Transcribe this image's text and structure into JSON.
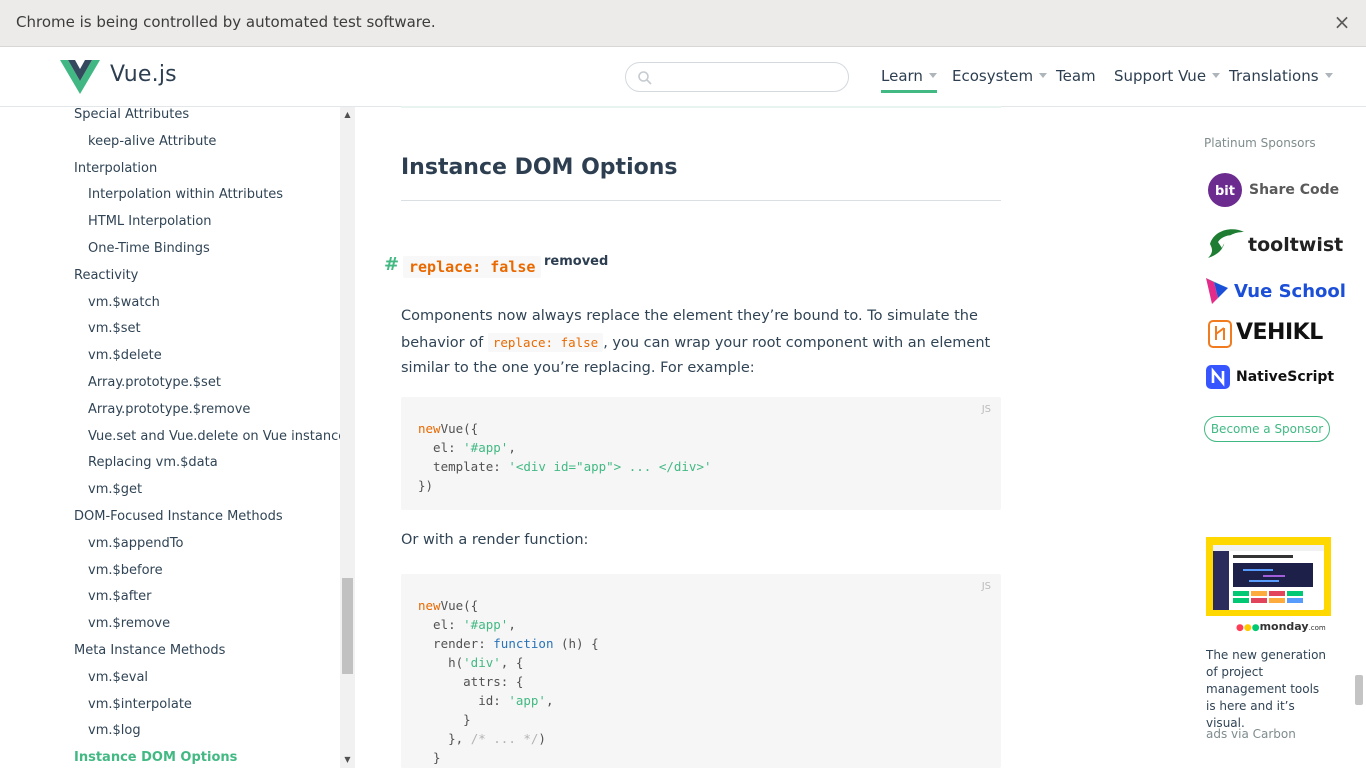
{
  "infobar": {
    "message": "Chrome is being controlled by automated test software.",
    "close_glyph": "×"
  },
  "header": {
    "brand": "Vue.js",
    "search_placeholder": "",
    "nav": {
      "learn": "Learn",
      "ecosystem": "Ecosystem",
      "team": "Team",
      "support": "Support Vue",
      "translations": "Translations"
    },
    "accent_color": "#42b983"
  },
  "sidebar": {
    "items": [
      {
        "label": "Special Attributes",
        "level": 1
      },
      {
        "label": "keep-alive Attribute",
        "level": 2
      },
      {
        "label": "Interpolation",
        "level": 1
      },
      {
        "label": "Interpolation within Attributes",
        "level": 2
      },
      {
        "label": "HTML Interpolation",
        "level": 2
      },
      {
        "label": "One-Time Bindings",
        "level": 2
      },
      {
        "label": "Reactivity",
        "level": 1
      },
      {
        "label": "vm.$watch",
        "level": 2
      },
      {
        "label": "vm.$set",
        "level": 2
      },
      {
        "label": "vm.$delete",
        "level": 2
      },
      {
        "label": "Array.prototype.$set",
        "level": 2
      },
      {
        "label": "Array.prototype.$remove",
        "level": 2
      },
      {
        "label": "Vue.set and Vue.delete on Vue instances",
        "level": 2
      },
      {
        "label": "Replacing vm.$data",
        "level": 2
      },
      {
        "label": "vm.$get",
        "level": 2
      },
      {
        "label": "DOM-Focused Instance Methods",
        "level": 1
      },
      {
        "label": "vm.$appendTo",
        "level": 2
      },
      {
        "label": "vm.$before",
        "level": 2
      },
      {
        "label": "vm.$after",
        "level": 2
      },
      {
        "label": "vm.$remove",
        "level": 2
      },
      {
        "label": "Meta Instance Methods",
        "level": 1
      },
      {
        "label": "vm.$eval",
        "level": 2
      },
      {
        "label": "vm.$interpolate",
        "level": 2
      },
      {
        "label": "vm.$log",
        "level": 2
      },
      {
        "label": "Instance DOM Options",
        "level": 1,
        "active": true
      }
    ]
  },
  "content": {
    "section_title": "Instance DOM Options",
    "anchor": "#",
    "heading_code": "replace: false",
    "heading_badge": "removed",
    "paragraph1": {
      "before": "Components now always replace the element they’re bound to. To simulate the behavior of ",
      "code": "replace: false",
      "after": ", you can wrap your root component with an element similar to the one you’re replacing. For example:"
    },
    "code1": {
      "lang": "JS",
      "lines": [
        [
          [
            "kw",
            "new"
          ],
          [
            "",
            "Vue({"
          ]
        ],
        [
          [
            "",
            "  el: "
          ],
          [
            "str",
            "'#app'"
          ],
          [
            "",
            ","
          ]
        ],
        [
          [
            "",
            "  template: "
          ],
          [
            "str",
            "'<div id=\"app\"> ... </div>'"
          ]
        ],
        [
          [
            "",
            "})"
          ]
        ]
      ]
    },
    "paragraph2": "Or with a render function:",
    "code2": {
      "lang": "JS",
      "lines": [
        [
          [
            "kw",
            "new"
          ],
          [
            "",
            "Vue({"
          ]
        ],
        [
          [
            "",
            "  el: "
          ],
          [
            "str",
            "'#app'"
          ],
          [
            "",
            ","
          ]
        ],
        [
          [
            "",
            "  render: "
          ],
          [
            "fn",
            "function"
          ],
          [
            "",
            " (h) {"
          ]
        ],
        [
          [
            "",
            "    h("
          ],
          [
            "str",
            "'div'"
          ],
          [
            "",
            ", {"
          ]
        ],
        [
          [
            "",
            "      attrs: {"
          ]
        ],
        [
          [
            "",
            "        id: "
          ],
          [
            "str",
            "'app'"
          ],
          [
            "",
            ","
          ]
        ],
        [
          [
            "",
            "      }"
          ]
        ],
        [
          [
            "",
            "    }, "
          ],
          [
            "cm",
            "/* ... */"
          ],
          [
            "",
            ")"
          ]
        ],
        [
          [
            "",
            "  }"
          ]
        ]
      ]
    }
  },
  "sponsors": {
    "title": "Platinum Sponsors",
    "list": [
      {
        "name": "Share Code",
        "logo": "bit",
        "color": "#6c2b8f"
      },
      {
        "name": "tooltwist",
        "color": "#1e7d32"
      },
      {
        "name": "Vue School",
        "color": "#1c4fd8"
      },
      {
        "name": "VEHIKL",
        "color": "#111111"
      },
      {
        "name": "NativeScript",
        "color": "#3655ff"
      }
    ],
    "cta": "Become a Sponsor"
  },
  "ad": {
    "brand": "monday",
    "brand_suffix": ".com",
    "text": "The new generation of project management tools is here and it’s visual.",
    "via": "ads via Carbon"
  }
}
